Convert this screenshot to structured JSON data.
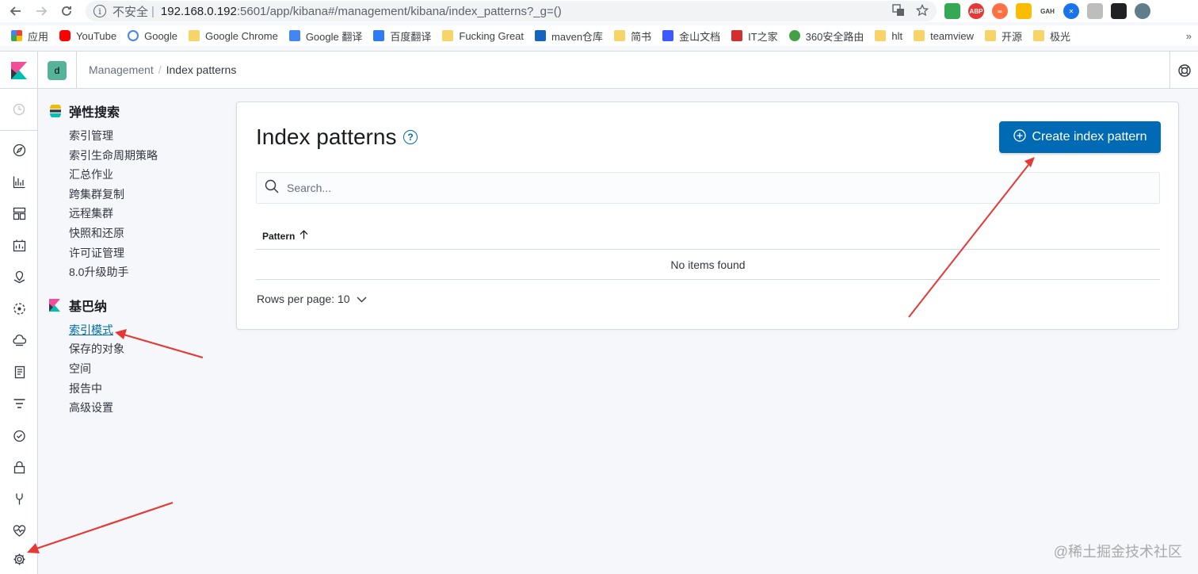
{
  "browser": {
    "address_security": "不安全",
    "address_host": "192.168.0.192",
    "address_path": ":5601/app/kibana#/management/kibana/index_patterns?_g=()",
    "bookmarks": [
      {
        "label": "应用",
        "icon": "apps-grid-icon"
      },
      {
        "label": "YouTube",
        "icon": "youtube-icon"
      },
      {
        "label": "Google",
        "icon": "google-icon"
      },
      {
        "label": "Google Chrome",
        "icon": "folder-icon"
      },
      {
        "label": "Google 翻译",
        "icon": "google-translate-icon"
      },
      {
        "label": "百度翻译",
        "icon": "baidu-translate-icon"
      },
      {
        "label": "Fucking Great",
        "icon": "folder-icon"
      },
      {
        "label": "maven仓库",
        "icon": "maven-icon"
      },
      {
        "label": "简书",
        "icon": "folder-icon"
      },
      {
        "label": "金山文档",
        "icon": "kingsoft-docs-icon"
      },
      {
        "label": "IT之家",
        "icon": "ithome-icon"
      },
      {
        "label": "360安全路由",
        "icon": "360-router-icon"
      },
      {
        "label": "hlt",
        "icon": "folder-icon"
      },
      {
        "label": "teamview",
        "icon": "folder-icon"
      },
      {
        "label": "开源",
        "icon": "folder-icon"
      },
      {
        "label": "极光",
        "icon": "folder-icon"
      }
    ],
    "bookmarks_more": "»"
  },
  "header": {
    "space_initial": "d",
    "breadcrumb_root": "Management",
    "breadcrumb_separator": "/",
    "breadcrumb_current": "Index patterns"
  },
  "sidebar": {
    "elasticsearch_title": "弹性搜索",
    "elasticsearch_items": [
      "索引管理",
      "索引生命周期策略",
      "汇总作业",
      "跨集群复制",
      "远程集群",
      "快照和还原",
      "许可证管理",
      "8.0升级助手"
    ],
    "kibana_title": "基巴纳",
    "kibana_items": [
      "索引模式",
      "保存的对象",
      "空间",
      "报告中",
      "高级设置"
    ]
  },
  "main": {
    "title": "Index patterns",
    "create_button_label": "Create index pattern",
    "search_placeholder": "Search...",
    "column_pattern": "Pattern",
    "empty_message": "No items found",
    "rows_per_page_label": "Rows per page: 10"
  },
  "watermark": "@稀土掘金技术社区",
  "colors": {
    "primary": "#006bb4",
    "annotation_arrow": "#e53935",
    "space_avatar": "#54b399"
  }
}
